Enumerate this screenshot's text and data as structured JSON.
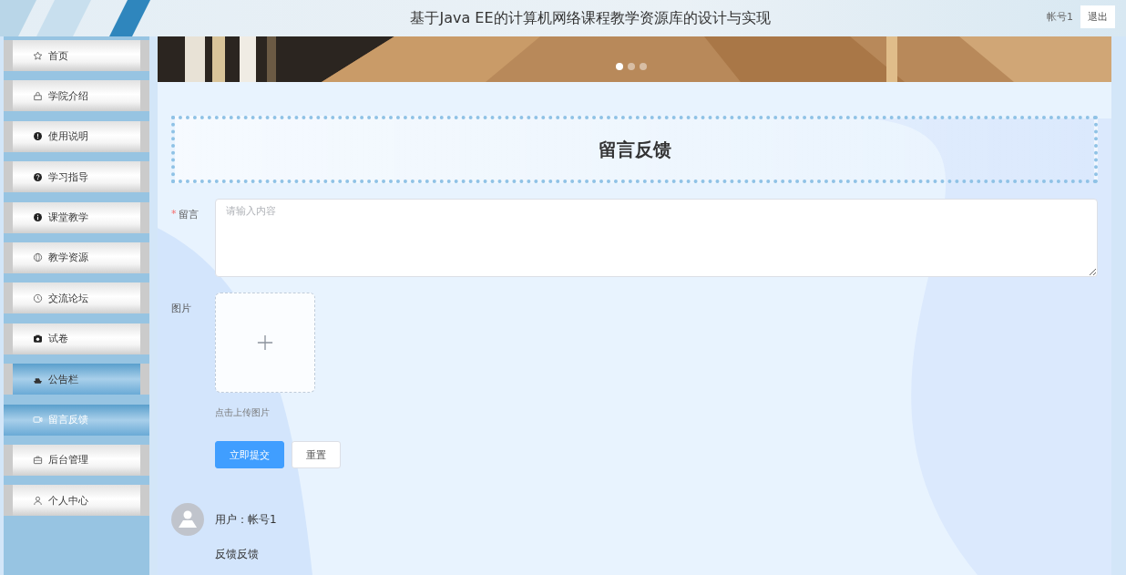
{
  "header": {
    "title": "基于Java EE的计算机网络课程教学资源库的设计与实现",
    "account": "帐号1",
    "logout": "退出"
  },
  "sidebar": {
    "items": [
      {
        "label": "首页",
        "selected": false,
        "hovered": false
      },
      {
        "label": "学院介绍",
        "selected": false,
        "hovered": false
      },
      {
        "label": "使用说明",
        "selected": false,
        "hovered": false
      },
      {
        "label": "学习指导",
        "selected": false,
        "hovered": false
      },
      {
        "label": "课堂教学",
        "selected": false,
        "hovered": false
      },
      {
        "label": "教学资源",
        "selected": false,
        "hovered": false
      },
      {
        "label": "交流论坛",
        "selected": false,
        "hovered": false
      },
      {
        "label": "试卷",
        "selected": false,
        "hovered": false
      },
      {
        "label": "公告栏",
        "selected": false,
        "hovered": true
      },
      {
        "label": "留言反馈",
        "selected": true,
        "hovered": false
      },
      {
        "label": "后台管理",
        "selected": false,
        "hovered": false
      },
      {
        "label": "个人中心",
        "selected": false,
        "hovered": false
      }
    ]
  },
  "banner": {
    "dots": [
      {
        "selected": true
      },
      {
        "selected": false
      },
      {
        "selected": false
      }
    ]
  },
  "page_title": "留言反馈",
  "form": {
    "message": {
      "label": "留言",
      "required": true,
      "required_mark": "*",
      "placeholder": "请输入内容"
    },
    "image": {
      "label": "图片",
      "hint": "点击上传图片"
    },
    "buttons": [
      {
        "label": "立即提交",
        "kind": "primary"
      },
      {
        "label": "重置",
        "kind": "plain"
      }
    ]
  },
  "comments": [
    {
      "user": "用户：帐号1",
      "text": "反馈反馈"
    }
  ]
}
